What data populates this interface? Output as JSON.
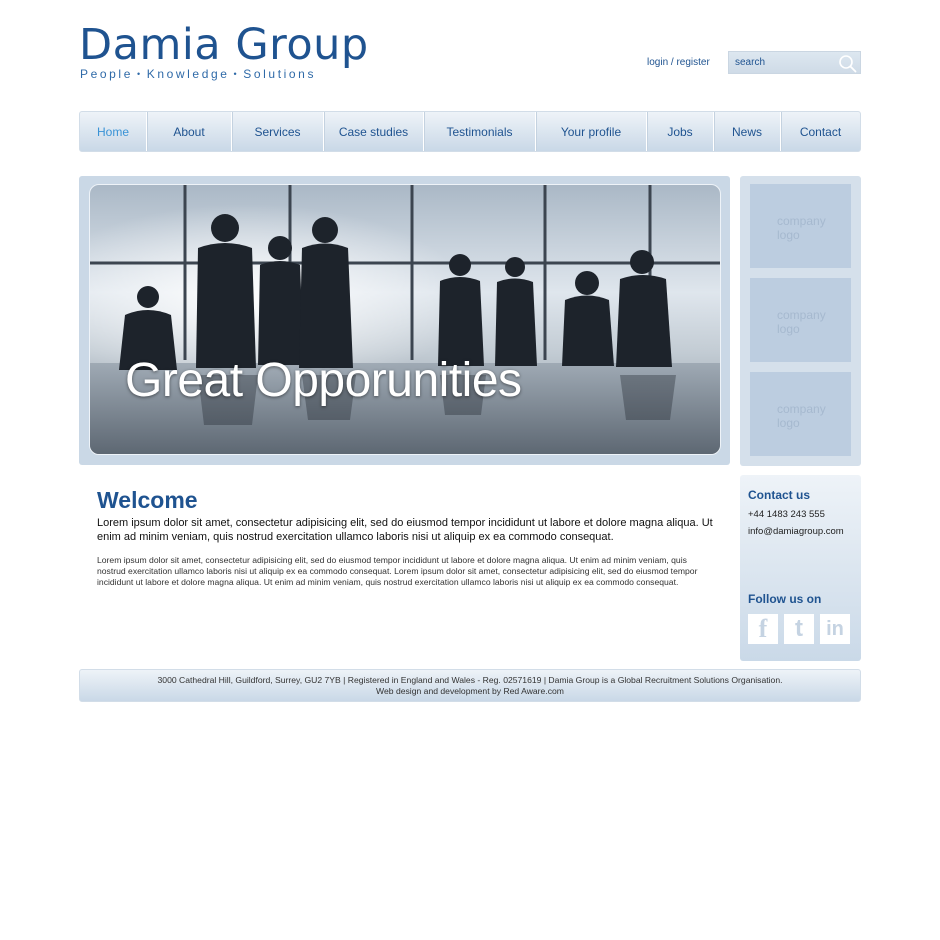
{
  "header": {
    "brand": "Damia Group",
    "tagline": [
      "People",
      "Knowledge",
      "Solutions"
    ],
    "login_link": "login / register",
    "search_placeholder": "search"
  },
  "nav": {
    "items": [
      {
        "label": "Home",
        "active": true
      },
      {
        "label": "About"
      },
      {
        "label": "Services"
      },
      {
        "label": "Case studies"
      },
      {
        "label": "Testimonials"
      },
      {
        "label": "Your profile"
      },
      {
        "label": "Jobs"
      },
      {
        "label": "News"
      },
      {
        "label": "Contact"
      }
    ]
  },
  "hero": {
    "headline": "Great Opporunities"
  },
  "logos": [
    {
      "label": "company logo"
    },
    {
      "label": "company logo"
    },
    {
      "label": "company logo"
    }
  ],
  "content": {
    "title": "Welcome",
    "lead": "Lorem ipsum dolor sit amet, consectetur adipisicing elit, sed do eiusmod tempor incididunt ut labore et dolore magna aliqua. Ut enim ad minim veniam, quis nostrud exercitation ullamco laboris nisi ut aliquip ex ea commodo consequat.",
    "body": "Lorem ipsum dolor sit amet, consectetur adipisicing elit, sed do eiusmod tempor incididunt ut labore et dolore magna aliqua. Ut enim ad minim veniam, quis nostrud exercitation ullamco laboris nisi ut aliquip ex ea commodo consequat. Lorem ipsum dolor sit amet, consectetur adipisicing elit, sed do eiusmod tempor incididunt ut labore et dolore magna aliqua. Ut enim ad minim veniam, quis nostrud exercitation ullamco laboris nisi ut aliquip ex ea commodo consequat."
  },
  "contact": {
    "title": "Contact us",
    "phone": "+44 1483 243 555",
    "email": "info@damiagroup.com",
    "follow_title": "Follow us on",
    "social": [
      "f",
      "t",
      "in"
    ]
  },
  "footer": {
    "line1": "3000 Cathedral Hill, Guildford, Surrey, GU2 7YB | Registered in England and Wales - Reg. 02571619 | Damia Group is a Global Recruitment Solutions Organisation.",
    "line2": "Web design and development by Red Aware.com"
  },
  "colors": {
    "brand_blue": "#1f5390",
    "active_nav": "#3a93d6",
    "panel": "#cad8e6"
  }
}
